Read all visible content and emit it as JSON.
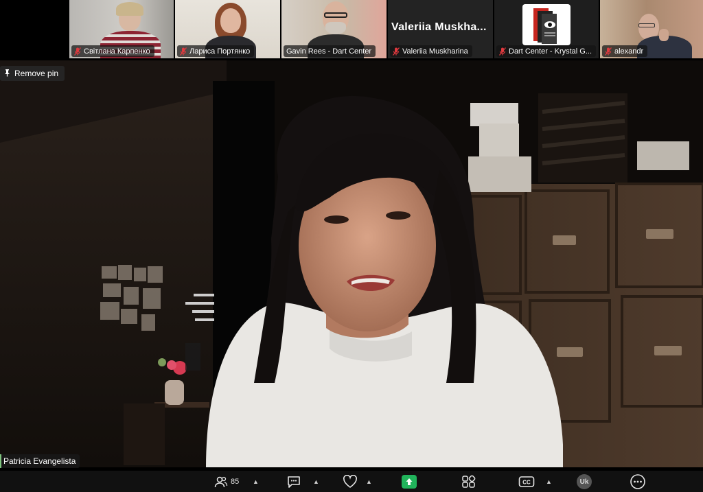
{
  "participants": [
    {
      "name": "Світлана Карпенко",
      "muted": true
    },
    {
      "name": "Лариса Портянко",
      "muted": true
    },
    {
      "name": "Gavin Rees - Dart Center",
      "muted": true
    },
    {
      "name": "Valeriia Muskharina",
      "muted": true,
      "display_title": "Valeriia  Muskha..."
    },
    {
      "name": "Dart Center - Krystal G...",
      "muted": true
    },
    {
      "name": "alexandr",
      "muted": true
    }
  ],
  "pin_button": {
    "label": "Remove pin",
    "icon": "pin-icon"
  },
  "active_speaker": {
    "name": "Patricia Evangelista"
  },
  "toolbar": {
    "participants_count": "85",
    "language_badge": "Uk"
  },
  "colors": {
    "share_green": "#21b35b",
    "muted_red": "#e0393e",
    "background": "#000000"
  }
}
